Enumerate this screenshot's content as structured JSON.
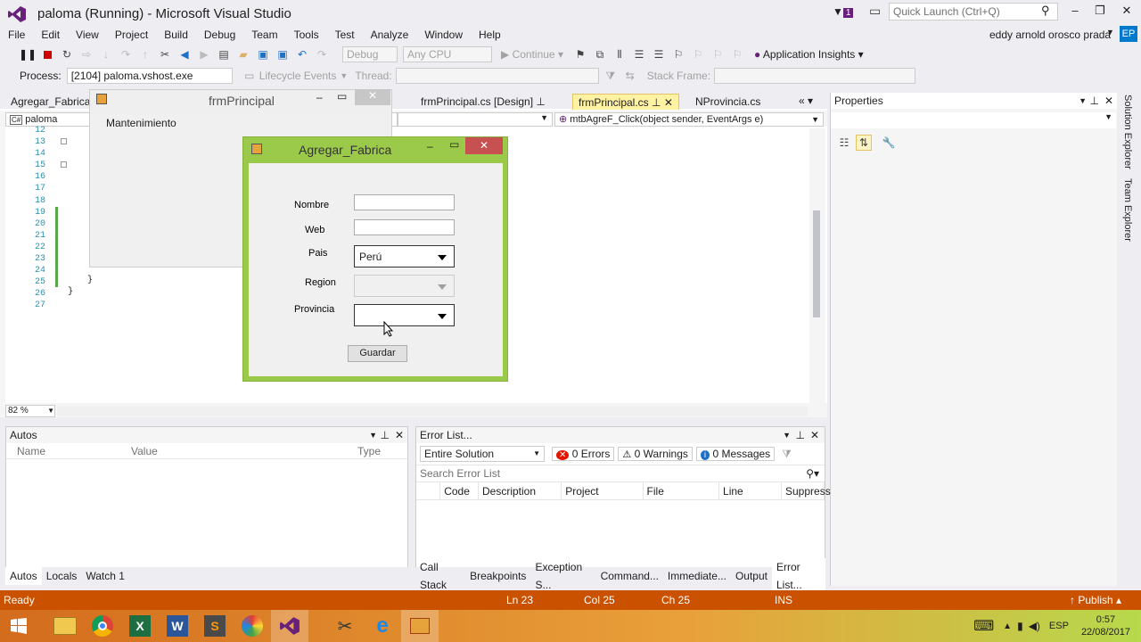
{
  "window": {
    "title": "paloma (Running) - Microsoft Visual Studio",
    "quick_launch_placeholder": "Quick Launch (Ctrl+Q)",
    "notification_count": "1"
  },
  "menu": [
    "File",
    "Edit",
    "View",
    "Project",
    "Build",
    "Debug",
    "Team",
    "Tools",
    "Test",
    "Analyze",
    "Window",
    "Help"
  ],
  "user": {
    "name": "eddy arnold orosco prada",
    "initials": "EP"
  },
  "toolbar": {
    "config": "Debug",
    "platform": "Any CPU",
    "continue_label": "Continue",
    "insights": "Application Insights"
  },
  "toolbar2": {
    "process_label": "Process:",
    "process_value": "[2104] paloma.vshost.exe",
    "lifecycle": "Lifecycle Events",
    "thread_label": "Thread:",
    "stack_frame_label": "Stack Frame:"
  },
  "doc_tabs": [
    {
      "label": "Agregar_Fabrica.c"
    },
    {
      "label": "frmPrincipal.cs [Design]"
    },
    {
      "label": "frmPrincipal.cs",
      "active": true
    },
    {
      "label": "NProvincia.cs"
    }
  ],
  "editor": {
    "project_dropdown": "paloma",
    "method_dropdown": "mtbAgreF_Click(object sender, EventArgs e)",
    "line_numbers": [
      "12",
      "13",
      "14",
      "15",
      "16",
      "17",
      "18",
      "19",
      "20",
      "21",
      "22",
      "23",
      "24",
      "25",
      "26",
      "27"
    ],
    "zoom": "82 %",
    "closing_braces": [
      "}",
      "}"
    ]
  },
  "bg_form": {
    "title": "frmPrincipal",
    "menu_item": "Mantenimiento"
  },
  "dialog": {
    "title": "Agregar_Fabrica",
    "labels": {
      "nombre": "Nombre",
      "web": "Web",
      "pais": "Pais",
      "region": "Region",
      "provincia": "Provincia"
    },
    "values": {
      "nombre": "",
      "web": "",
      "pais": "Perú",
      "region": "",
      "provincia": ""
    },
    "save_button": "Guardar"
  },
  "properties": {
    "title": "Properties"
  },
  "side_tabs": [
    "Solution Explorer",
    "Team Explorer"
  ],
  "autos": {
    "title": "Autos",
    "columns": [
      "Name",
      "Value",
      "Type"
    ],
    "tabs": [
      "Autos",
      "Locals",
      "Watch 1"
    ]
  },
  "errors": {
    "title": "Error List...",
    "scope": "Entire Solution",
    "errors_count": "0 Errors",
    "warnings_count": "0 Warnings",
    "messages_count": "0 Messages",
    "search_placeholder": "Search Error List",
    "columns": [
      "Code",
      "Description",
      "Project",
      "File",
      "Line",
      "Suppress"
    ],
    "tabs": [
      "Call Stack",
      "Breakpoints",
      "Exception S...",
      "Command...",
      "Immediate...",
      "Output",
      "Error List..."
    ]
  },
  "status": {
    "left": "Ready",
    "ln": "Ln 23",
    "col": "Col 25",
    "ch": "Ch 25",
    "mode": "INS",
    "publish": "Publish"
  },
  "taskbar": {
    "lang": "ESP",
    "time": "0:57",
    "date": "22/08/2017"
  },
  "colors": {
    "status_orange": "#ca5100",
    "dialog_frame": "#9bc94a",
    "accent_blue": "#007acc",
    "tab_active": "#fff"
  }
}
